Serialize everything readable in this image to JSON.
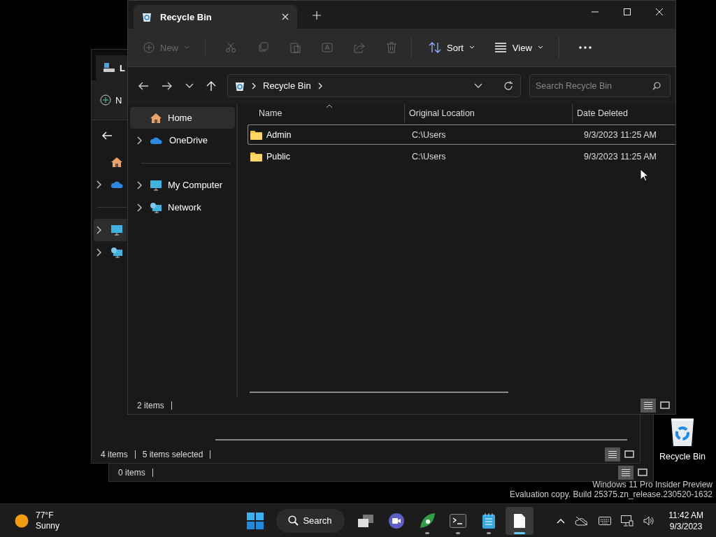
{
  "desktop": {
    "icons": [
      {
        "label": "Recycle Bin"
      }
    ],
    "watermark": [
      "Windows 11 Pro Insider Preview",
      "Evaluation copy. Build 25375.zn_release.230520-1632"
    ]
  },
  "back_windows": [
    {
      "tab_title": "L",
      "new_label": "N",
      "nav_groups": [
        [
          {
            "kind": "home",
            "expandable": false,
            "selected": false
          },
          {
            "kind": "cloud",
            "expandable": true,
            "selected": false
          }
        ],
        [
          {
            "kind": "computer",
            "expandable": true,
            "selected": true
          },
          {
            "kind": "network",
            "expandable": true,
            "selected": false
          }
        ]
      ],
      "status_items": [
        "4 items",
        "5 items selected"
      ],
      "view_modes": [
        {
          "kind": "details",
          "selected": true
        },
        {
          "kind": "tiles",
          "selected": false
        }
      ]
    },
    {
      "status_items": [
        "0 items"
      ],
      "view_modes": [
        {
          "kind": "details",
          "selected": true
        },
        {
          "kind": "tiles",
          "selected": false
        }
      ]
    }
  ],
  "window": {
    "tab": {
      "title": "Recycle Bin",
      "selected": true
    },
    "toolbar": [
      {
        "kind": "new",
        "label": "New",
        "disabled": true
      },
      {
        "kind": "cut",
        "disabled": true
      },
      {
        "kind": "copy",
        "disabled": true
      },
      {
        "kind": "paste",
        "disabled": true
      },
      {
        "kind": "rename",
        "disabled": true
      },
      {
        "kind": "share",
        "disabled": true
      },
      {
        "kind": "delete",
        "disabled": true
      },
      {
        "kind": "sort",
        "label": "Sort",
        "disabled": false
      },
      {
        "kind": "view",
        "label": "View",
        "disabled": false
      },
      {
        "kind": "more",
        "disabled": false
      }
    ],
    "breadcrumb": [
      "Recycle Bin"
    ],
    "search": {
      "placeholder": "Search Recycle Bin"
    },
    "sidebar": {
      "groups": [
        [
          {
            "kind": "home",
            "label": "Home",
            "expandable": false,
            "selected": true
          },
          {
            "kind": "cloud",
            "label": "OneDrive",
            "expandable": true,
            "selected": false
          }
        ],
        [
          {
            "kind": "computer",
            "label": "My Computer",
            "expandable": true,
            "selected": false
          },
          {
            "kind": "network",
            "label": "Network",
            "expandable": true,
            "selected": false
          }
        ]
      ]
    },
    "table": {
      "columns": [
        {
          "label": "Name",
          "sorted": true
        },
        {
          "label": "Original Location",
          "sorted": false
        },
        {
          "label": "Date Deleted",
          "sorted": false
        }
      ],
      "rows": [
        {
          "name": "Admin",
          "location": "C:\\Users",
          "date": "9/3/2023 11:25 AM",
          "focused": true
        },
        {
          "name": "Public",
          "location": "C:\\Users",
          "date": "9/3/2023 11:25 AM",
          "focused": false
        }
      ]
    },
    "status_items": [
      "2 items"
    ],
    "view_modes": [
      {
        "kind": "details",
        "selected": true
      },
      {
        "kind": "tiles",
        "selected": false
      }
    ]
  },
  "taskbar": {
    "weather": {
      "temperature": "77°F",
      "condition": "Sunny"
    },
    "apps": [
      {
        "kind": "start",
        "running": false,
        "active": false
      },
      {
        "kind": "search",
        "label": "Search",
        "running": false,
        "active": false
      },
      {
        "kind": "taskview",
        "running": false,
        "active": false
      },
      {
        "kind": "meet",
        "running": false,
        "active": false
      },
      {
        "kind": "leaf",
        "running": true,
        "active": false
      },
      {
        "kind": "terminal",
        "running": true,
        "active": false
      },
      {
        "kind": "notepad",
        "running": true,
        "active": false
      },
      {
        "kind": "file",
        "running": true,
        "active": true
      }
    ],
    "tray": [
      {
        "kind": "chevron"
      },
      {
        "kind": "cloud-off"
      },
      {
        "kind": "keyboard"
      },
      {
        "kind": "network"
      },
      {
        "kind": "volume"
      }
    ],
    "time": "11:42 AM",
    "date": "9/3/2023"
  }
}
